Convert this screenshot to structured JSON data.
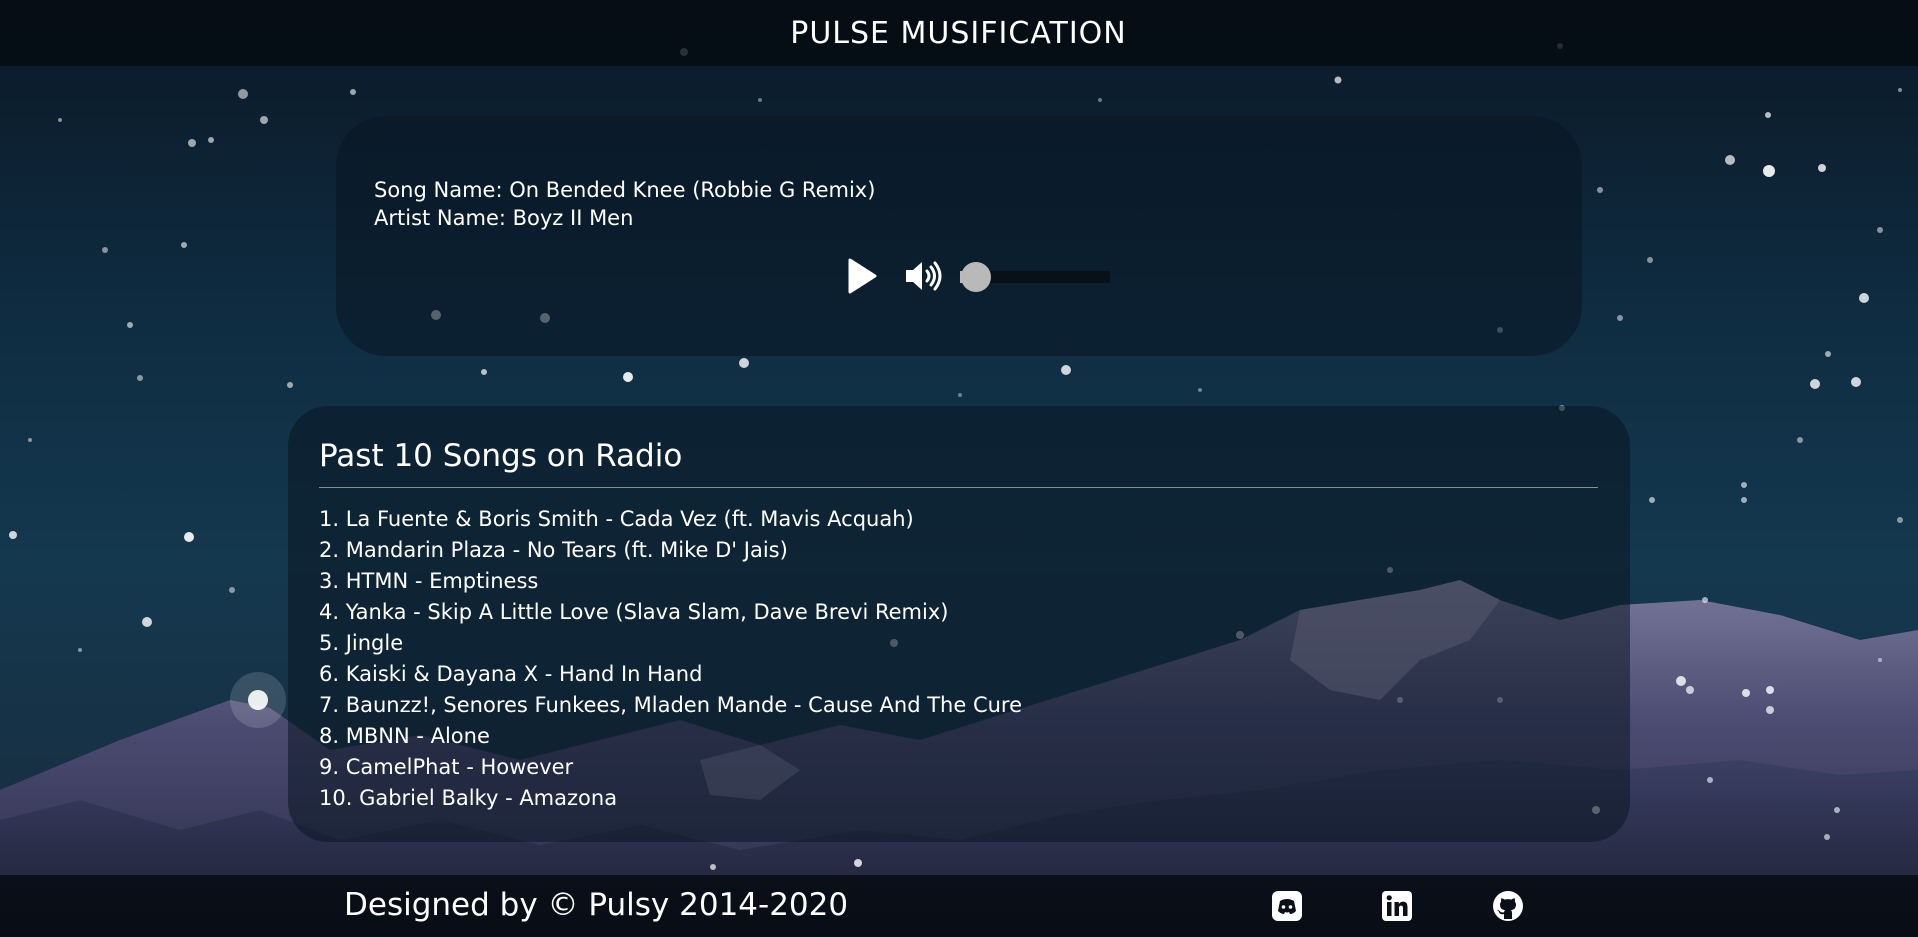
{
  "header": {
    "title": "PULSE MUSIFICATION"
  },
  "player": {
    "song_line": "Song Name: On Bended Knee (Robbie G Remix)",
    "artist_line": "Artist Name: Boyz II Men",
    "play_icon": "play-icon",
    "volume_icon": "volume-icon",
    "volume_level": 0.02
  },
  "history": {
    "title": "Past 10 Songs on Radio",
    "songs": [
      "1. La Fuente & Boris Smith - Cada Vez (ft. Mavis Acquah)",
      "2. Mandarin Plaza - No Tears (ft. Mike D' Jais)",
      "3. HTMN - Emptiness",
      "4. Yanka - Skip A Little Love (Slava Slam, Dave Brevi Remix)",
      "5. Jingle",
      "6. Kaiski & Dayana X - Hand In Hand",
      "7. Baunzz!, Senores Funkees, Mladen Mande - Cause And The Cure",
      "8. MBNN - Alone",
      "9. CamelPhat - However",
      "10. Gabriel Balky - Amazona"
    ]
  },
  "footer": {
    "text": "Designed by © Pulsy 2014-2020",
    "social_icons": [
      "discord-icon",
      "linkedin-icon",
      "github-icon"
    ]
  },
  "colors": {
    "text": "#ffffff",
    "panel": "#0a1622",
    "bar": "#050a10",
    "slider_thumb": "#b9b9b9"
  }
}
